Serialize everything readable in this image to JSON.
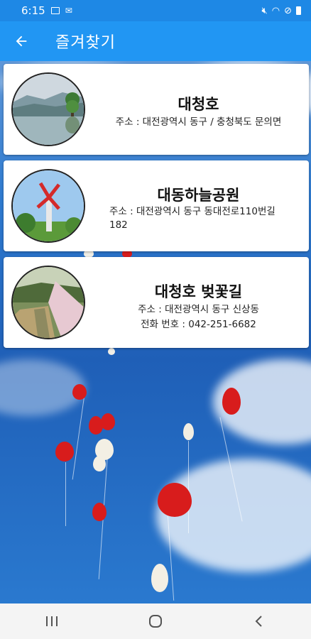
{
  "status_bar": {
    "time": "6:15"
  },
  "app_bar": {
    "title": "즐겨찾기"
  },
  "favorites": [
    {
      "name": "대청호",
      "lines": [
        "주소 : 대전광역시 동구 / 충청북도 문의면"
      ]
    },
    {
      "name": "대동하늘공원",
      "lines": [
        "주소 : 대전광역시 동구 동대전로110번길",
        "182"
      ]
    },
    {
      "name": "대청호 벚꽃길",
      "lines": [
        "주소 : 대전광역시 동구 신상동",
        "전화 번호 : 042-251-6682"
      ]
    }
  ],
  "colors": {
    "status_bar": "#1e88e5",
    "app_bar": "#2196f3"
  },
  "icons": {
    "back": "arrow-back-icon",
    "nav_recent": "recent-apps-icon",
    "nav_home": "home-icon",
    "nav_back": "nav-back-icon"
  }
}
